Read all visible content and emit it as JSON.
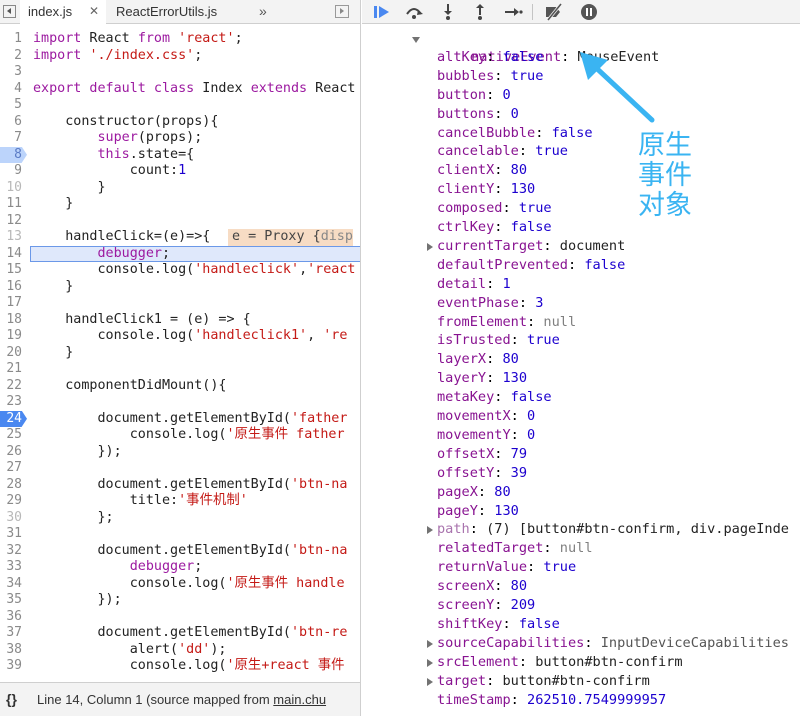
{
  "tabs": [
    {
      "label": "index.js",
      "close": "✕",
      "active": true
    },
    {
      "label": "ReactErrorUtils.js",
      "close": "",
      "active": false
    }
  ],
  "more_tabs_icon": "chevrons-right-icon",
  "code_lines": [
    {
      "n": "1",
      "tokens": [
        [
          "k",
          "import"
        ],
        [
          "p",
          " React "
        ],
        [
          "k",
          "from"
        ],
        [
          "p",
          " "
        ],
        [
          "s",
          "'react'"
        ],
        [
          "p",
          ";"
        ]
      ]
    },
    {
      "n": "2",
      "tokens": [
        [
          "k",
          "import"
        ],
        [
          "p",
          " "
        ],
        [
          "s",
          "'./index.css'"
        ],
        [
          "p",
          ";"
        ]
      ]
    },
    {
      "n": "3",
      "tokens": []
    },
    {
      "n": "4",
      "tokens": [
        [
          "k",
          "export default class"
        ],
        [
          "p",
          " Index "
        ],
        [
          "k",
          "extends"
        ],
        [
          "p",
          " React"
        ]
      ]
    },
    {
      "n": "5",
      "tokens": []
    },
    {
      "n": "6",
      "tokens": [
        [
          "p",
          "    constructor(props){"
        ]
      ]
    },
    {
      "n": "7",
      "tokens": [
        [
          "p",
          "        "
        ],
        [
          "k",
          "super"
        ],
        [
          "p",
          "(props);"
        ]
      ]
    },
    {
      "n": "8",
      "state": "bp-disabled",
      "tokens": [
        [
          "p",
          "        "
        ],
        [
          "k",
          "this"
        ],
        [
          "p",
          ".state={"
        ]
      ]
    },
    {
      "n": "9",
      "tokens": [
        [
          "p",
          "            count:"
        ],
        [
          "v",
          "1"
        ]
      ]
    },
    {
      "n": "10",
      "state": "dim",
      "tokens": [
        [
          "p",
          "        }"
        ]
      ]
    },
    {
      "n": "11",
      "tokens": [
        [
          "p",
          "    }"
        ]
      ]
    },
    {
      "n": "12",
      "tokens": []
    },
    {
      "n": "13",
      "state": "dim",
      "tokens": [
        [
          "p",
          "    handleClick=(e)=>{"
        ]
      ]
    },
    {
      "n": "14",
      "current": true,
      "tokens": [
        [
          "p",
          "        "
        ],
        [
          "k",
          "debugger"
        ],
        [
          "p",
          ";"
        ]
      ]
    },
    {
      "n": "15",
      "tokens": [
        [
          "p",
          "        console.log("
        ],
        [
          "s",
          "'handleclick'"
        ],
        [
          "p",
          ","
        ],
        [
          "s",
          "'react"
        ]
      ]
    },
    {
      "n": "16",
      "tokens": [
        [
          "p",
          "    }"
        ]
      ]
    },
    {
      "n": "17",
      "tokens": []
    },
    {
      "n": "18",
      "tokens": [
        [
          "p",
          "    handleClick1 = (e) => {"
        ]
      ]
    },
    {
      "n": "19",
      "tokens": [
        [
          "p",
          "        console.log("
        ],
        [
          "s",
          "'handleclick1'"
        ],
        [
          "p",
          ", "
        ],
        [
          "s",
          "'re"
        ]
      ]
    },
    {
      "n": "20",
      "tokens": [
        [
          "p",
          "    }"
        ]
      ]
    },
    {
      "n": "21",
      "tokens": []
    },
    {
      "n": "22",
      "tokens": [
        [
          "p",
          "    componentDidMount(){"
        ]
      ]
    },
    {
      "n": "23",
      "tokens": []
    },
    {
      "n": "24",
      "state": "bp",
      "tokens": [
        [
          "p",
          "        document.getElementById("
        ],
        [
          "s",
          "'father"
        ]
      ]
    },
    {
      "n": "25",
      "tokens": [
        [
          "p",
          "            console.log("
        ],
        [
          "s",
          "'原生事件 father"
        ]
      ]
    },
    {
      "n": "26",
      "tokens": [
        [
          "p",
          "        });"
        ]
      ]
    },
    {
      "n": "27",
      "tokens": []
    },
    {
      "n": "28",
      "tokens": [
        [
          "p",
          "        document.getElementById("
        ],
        [
          "s",
          "'btn-na"
        ]
      ]
    },
    {
      "n": "29",
      "tokens": [
        [
          "p",
          "            title:"
        ],
        [
          "s",
          "'事件机制'"
        ]
      ]
    },
    {
      "n": "30",
      "state": "dim",
      "tokens": [
        [
          "p",
          "        };"
        ]
      ]
    },
    {
      "n": "31",
      "tokens": []
    },
    {
      "n": "32",
      "tokens": [
        [
          "p",
          "        document.getElementById("
        ],
        [
          "s",
          "'btn-na"
        ]
      ]
    },
    {
      "n": "33",
      "tokens": [
        [
          "p",
          "            "
        ],
        [
          "k",
          "debugger"
        ],
        [
          "p",
          ";"
        ]
      ]
    },
    {
      "n": "34",
      "tokens": [
        [
          "p",
          "            console.log("
        ],
        [
          "s",
          "'原生事件 handle"
        ]
      ]
    },
    {
      "n": "35",
      "tokens": [
        [
          "p",
          "        });"
        ]
      ]
    },
    {
      "n": "36",
      "tokens": []
    },
    {
      "n": "37",
      "tokens": [
        [
          "p",
          "        document.getElementById("
        ],
        [
          "s",
          "'btn-re"
        ]
      ]
    },
    {
      "n": "38",
      "tokens": [
        [
          "p",
          "            alert("
        ],
        [
          "s",
          "'dd'"
        ],
        [
          "p",
          ");"
        ]
      ]
    },
    {
      "n": "39",
      "tokens": [
        [
          "p",
          "            console.log("
        ],
        [
          "s",
          "'原生+react 事件"
        ]
      ]
    }
  ],
  "inline_value": {
    "main": "e = Proxy {",
    "dim": "disp"
  },
  "status": {
    "braces": "{}",
    "text": "Line 14, Column 1  (source mapped from ",
    "link": "main.chu"
  },
  "toolbar_icons": [
    "resume-icon",
    "step-over-icon",
    "step-into-icon",
    "step-out-icon",
    "step-icon",
    "deactivate-breakpoints-icon",
    "pause-on-exceptions-icon"
  ],
  "scope": {
    "header": {
      "key": "nativeEvent",
      "value": "MouseEvent"
    },
    "props": [
      {
        "key": "altKey",
        "value": "false",
        "kind": "num"
      },
      {
        "key": "bubbles",
        "value": "true",
        "kind": "num"
      },
      {
        "key": "button",
        "value": "0",
        "kind": "num"
      },
      {
        "key": "buttons",
        "value": "0",
        "kind": "num"
      },
      {
        "key": "cancelBubble",
        "value": "false",
        "kind": "num"
      },
      {
        "key": "cancelable",
        "value": "true",
        "kind": "num"
      },
      {
        "key": "clientX",
        "value": "80",
        "kind": "num"
      },
      {
        "key": "clientY",
        "value": "130",
        "kind": "num"
      },
      {
        "key": "composed",
        "value": "true",
        "kind": "num"
      },
      {
        "key": "ctrlKey",
        "value": "false",
        "kind": "num"
      },
      {
        "key": "currentTarget",
        "value": "document",
        "kind": "obj",
        "expandable": true
      },
      {
        "key": "defaultPrevented",
        "value": "false",
        "kind": "num"
      },
      {
        "key": "detail",
        "value": "1",
        "kind": "num"
      },
      {
        "key": "eventPhase",
        "value": "3",
        "kind": "num"
      },
      {
        "key": "fromElement",
        "value": "null",
        "kind": "null"
      },
      {
        "key": "isTrusted",
        "value": "true",
        "kind": "num"
      },
      {
        "key": "layerX",
        "value": "80",
        "kind": "num"
      },
      {
        "key": "layerY",
        "value": "130",
        "kind": "num"
      },
      {
        "key": "metaKey",
        "value": "false",
        "kind": "num"
      },
      {
        "key": "movementX",
        "value": "0",
        "kind": "num"
      },
      {
        "key": "movementY",
        "value": "0",
        "kind": "num"
      },
      {
        "key": "offsetX",
        "value": "79",
        "kind": "num"
      },
      {
        "key": "offsetY",
        "value": "39",
        "kind": "num"
      },
      {
        "key": "pageX",
        "value": "80",
        "kind": "num"
      },
      {
        "key": "pageY",
        "value": "130",
        "kind": "num"
      },
      {
        "key": "path",
        "value": "(7) [button#btn-confirm, div.pageInde",
        "kind": "obj",
        "expandable": true,
        "dim_key": true
      },
      {
        "key": "relatedTarget",
        "value": "null",
        "kind": "null"
      },
      {
        "key": "returnValue",
        "value": "true",
        "kind": "num"
      },
      {
        "key": "screenX",
        "value": "80",
        "kind": "num"
      },
      {
        "key": "screenY",
        "value": "209",
        "kind": "num"
      },
      {
        "key": "shiftKey",
        "value": "false",
        "kind": "num"
      },
      {
        "key": "sourceCapabilities",
        "value": "InputDeviceCapabilities",
        "kind": "dim",
        "expandable": true
      },
      {
        "key": "srcElement",
        "value": "button#btn-confirm",
        "kind": "obj",
        "expandable": true
      },
      {
        "key": "target",
        "value": "button#btn-confirm",
        "kind": "obj",
        "expandable": true
      },
      {
        "key": "timeStamp",
        "value": "262510.7549999957",
        "kind": "num"
      }
    ]
  },
  "annotation": {
    "lines": [
      "原生",
      "事件",
      "对象"
    ],
    "color": "#3ab4f2"
  },
  "colors": {
    "keyword": "#9c1aa0",
    "string": "#c41a16",
    "number": "#1c00cf",
    "prop_key": "#881391",
    "breakpoint": "#4a88f0"
  }
}
